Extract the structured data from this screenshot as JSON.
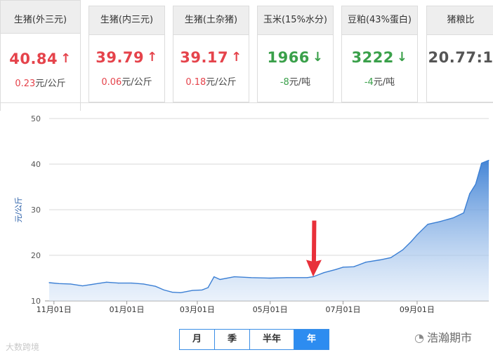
{
  "cards": [
    {
      "name": "生猪(外三元)",
      "price": "40.84",
      "direction": "up",
      "change": "0.23",
      "unit": "元/公斤"
    },
    {
      "name": "生猪(内三元)",
      "price": "39.79",
      "direction": "up",
      "change": "0.06",
      "unit": "元/公斤"
    },
    {
      "name": "生猪(土杂猪)",
      "price": "39.17",
      "direction": "up",
      "change": "0.18",
      "unit": "元/公斤"
    },
    {
      "name": "玉米(15%水分)",
      "price": "1966",
      "direction": "down",
      "change": "-8",
      "unit": "元/吨"
    },
    {
      "name": "豆粕(43%蛋白)",
      "price": "3222",
      "direction": "down",
      "change": "-4",
      "unit": "元/吨"
    },
    {
      "name": "猪粮比",
      "price": "20.77:1",
      "direction": "none",
      "change": "",
      "unit": ""
    }
  ],
  "icons": {
    "up": "arrow-up-icon",
    "down": "arrow-down-icon"
  },
  "colors": {
    "up": "#e5434b",
    "down": "#3aa04a",
    "series": "#3b7fd4",
    "marker": "#e8303a",
    "selected": "#2d8cf0"
  },
  "range": {
    "options": [
      "月",
      "季",
      "半年",
      "年"
    ],
    "selected": "年"
  },
  "watermark_left": "大数跨境",
  "watermark_right": "浩瀚期市",
  "chart_data": {
    "type": "area",
    "title": "",
    "xlabel": "",
    "ylabel": "元/公斤",
    "ylim": [
      10,
      50
    ],
    "yticks": [
      10,
      20,
      30,
      40,
      50
    ],
    "x_tick_labels": [
      "11月01日",
      "01月01日",
      "03月01日",
      "05月01日",
      "07月01日",
      "09月01日"
    ],
    "x_tick_dates": [
      "2018-11-01",
      "2019-01-01",
      "2019-03-01",
      "2019-05-01",
      "2019-07-01",
      "2019-09-01"
    ],
    "xlim": [
      "2018-10-28",
      "2019-10-31"
    ],
    "grid": "horizontal",
    "legend": "none",
    "annotation": {
      "type": "arrow",
      "date": "2019-06-06",
      "value": 15.3
    },
    "series": [
      {
        "x": [
          "2018-10-28",
          "2018-11-05",
          "2018-11-15",
          "2018-11-25",
          "2018-12-05",
          "2018-12-15",
          "2018-12-25",
          "2019-01-05",
          "2019-01-15",
          "2019-01-25",
          "2019-02-01",
          "2019-02-08",
          "2019-02-15",
          "2019-02-25",
          "2019-03-05",
          "2019-03-10",
          "2019-03-15",
          "2019-03-20",
          "2019-04-01",
          "2019-04-15",
          "2019-05-01",
          "2019-05-15",
          "2019-06-01",
          "2019-06-06",
          "2019-06-15",
          "2019-06-25",
          "2019-07-01",
          "2019-07-10",
          "2019-07-20",
          "2019-08-01",
          "2019-08-10",
          "2019-08-20",
          "2019-08-27",
          "2019-09-01",
          "2019-09-10",
          "2019-09-20",
          "2019-10-01",
          "2019-10-10",
          "2019-10-15",
          "2019-10-20",
          "2019-10-25",
          "2019-10-31"
        ],
        "values": [
          14.0,
          13.8,
          13.7,
          13.3,
          13.7,
          14.1,
          13.9,
          13.9,
          13.7,
          13.2,
          12.4,
          11.9,
          11.8,
          12.3,
          12.4,
          12.9,
          15.3,
          14.7,
          15.3,
          15.1,
          15.0,
          15.1,
          15.1,
          15.3,
          16.2,
          16.9,
          17.4,
          17.5,
          18.5,
          19.0,
          19.5,
          21.2,
          23.0,
          24.5,
          26.8,
          27.4,
          28.2,
          29.3,
          33.5,
          35.6,
          40.2,
          40.84
        ]
      }
    ]
  }
}
